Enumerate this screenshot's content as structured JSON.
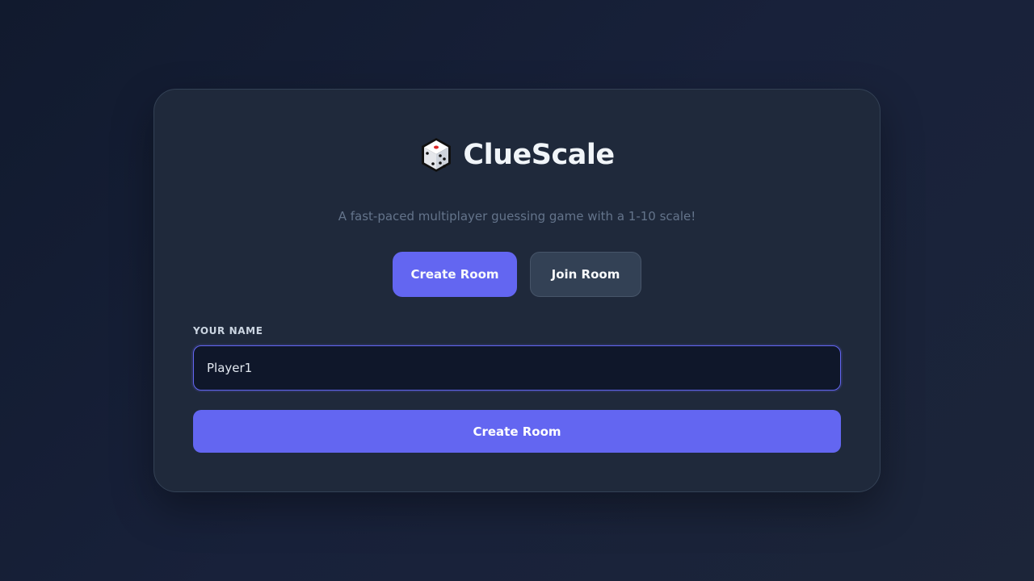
{
  "app": {
    "title": "ClueScale",
    "logo_icon": "dice-icon",
    "tagline": "A fast-paced multiplayer guessing game with a 1-10 scale!"
  },
  "mode_tabs": {
    "create_label": "Create Room",
    "join_label": "Join Room",
    "active": "create"
  },
  "form": {
    "name_label": "YOUR NAME",
    "name_value": "Player1",
    "submit_label": "Create Room"
  },
  "colors": {
    "accent": "#6366f1",
    "card_bg": "#1f293b",
    "page_bg": "#131b2e",
    "input_bg": "#0f172a",
    "inactive_button": "#334155"
  }
}
